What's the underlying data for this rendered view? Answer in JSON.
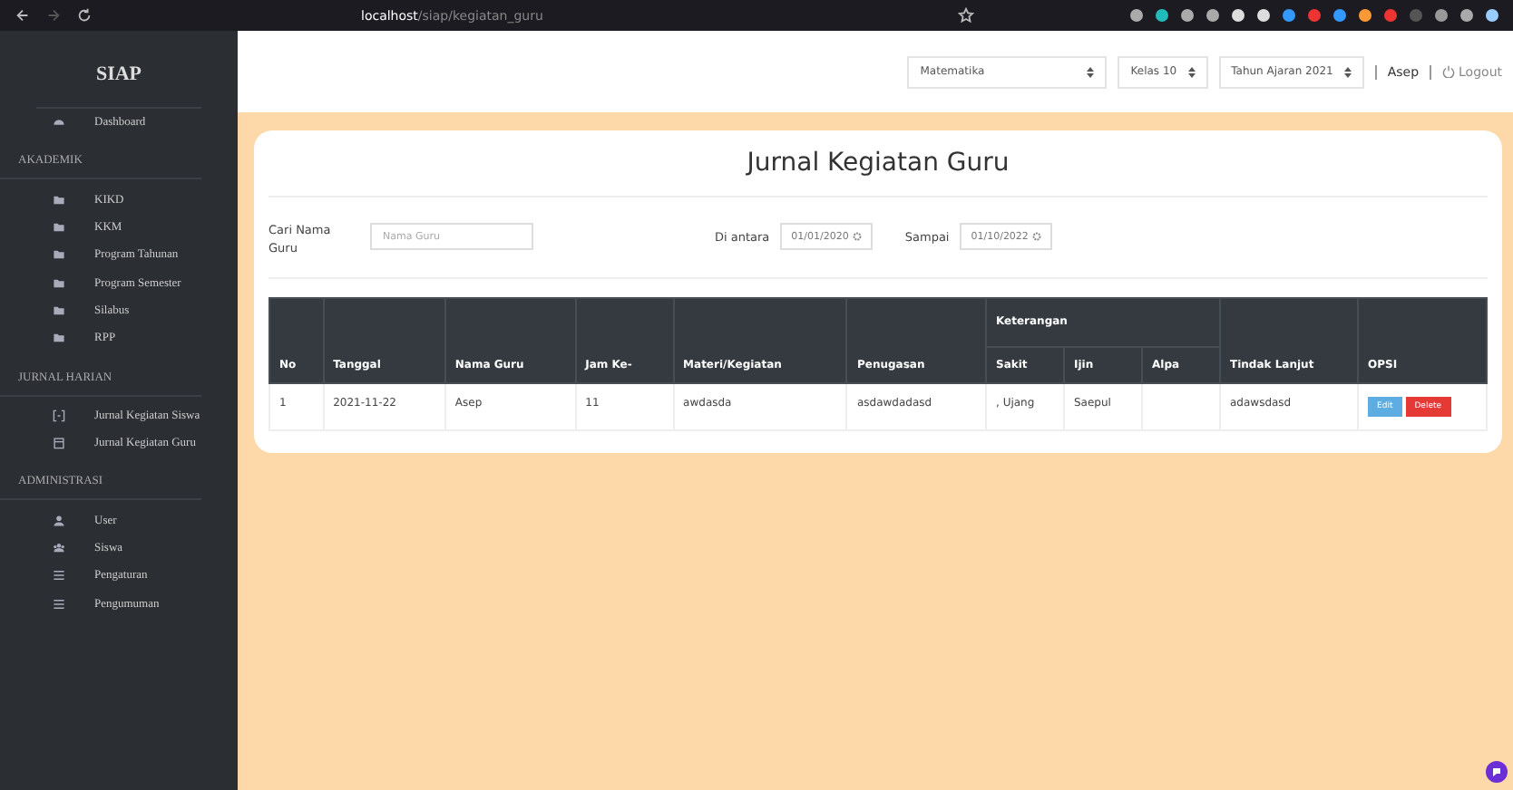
{
  "browser": {
    "url_host": "localhost",
    "url_path": "/siap/kegiatan_guru"
  },
  "sidebar": {
    "brand": "SIAP",
    "items": [
      {
        "kind": "gauge",
        "label": "Dashboard",
        "selected": false
      },
      {
        "kind": "heading",
        "label": "AKADEMIK"
      },
      {
        "kind": "folder",
        "label": "KIKD",
        "selected": false
      },
      {
        "kind": "folder",
        "label": "KKM",
        "selected": false
      },
      {
        "kind": "folder",
        "label": "Program Tahunan",
        "selected": false
      },
      {
        "kind": "folder",
        "label": "Program Semester",
        "selected": false
      },
      {
        "kind": "folder",
        "label": "Silabus",
        "selected": false
      },
      {
        "kind": "folder",
        "label": "RPP",
        "selected": false
      },
      {
        "kind": "heading",
        "label": "JURNAL HARIAN"
      },
      {
        "kind": "brackets",
        "label": "Jurnal Kegiatan Siswa",
        "selected": false
      },
      {
        "kind": "calendar",
        "label": "Jurnal Kegiatan Guru",
        "selected": false
      },
      {
        "kind": "heading",
        "label": "ADMINISTRASI"
      },
      {
        "kind": "user",
        "label": "User",
        "selected": false
      },
      {
        "kind": "users",
        "label": "Siswa",
        "selected": false
      },
      {
        "kind": "bars",
        "label": "Pengaturan",
        "selected": false
      },
      {
        "kind": "bars",
        "label": "Pengumuman",
        "selected": false
      }
    ]
  },
  "header": {
    "selects": [
      {
        "value": "Matematika"
      },
      {
        "value": "Kelas 10"
      },
      {
        "value": "Tahun Ajaran 2021"
      }
    ],
    "user": "Asep",
    "logout": "Logout"
  },
  "card": {
    "title": "Jurnal Kegiatan Guru",
    "filters": {
      "search_label": "Cari Nama Guru",
      "search_placeholder": "Nama Guru",
      "from_label": "Di antara",
      "from_value": "01/01/2020",
      "to_label": "Sampai",
      "to_value": "01/10/2022"
    },
    "table": {
      "columns": [
        "No",
        "Tanggal",
        "Nama Guru",
        "Jam Ke-",
        "Materi/Kegiatan",
        "Penugasan",
        "Keterangan",
        "Tindak Lanjut",
        "OPSI"
      ],
      "sub_columns": [
        "Sakit",
        "Ijin",
        "Alpa"
      ],
      "rows": [
        {
          "no": "1",
          "tanggal": "2021-11-22",
          "nama_guru": "Asep",
          "jam_ke": "11",
          "materi": "awdasda",
          "penugasan": "asdawdadasd",
          "sakit": ", Ujang",
          "ijin": "Saepul",
          "tindak_lanjut": "adawsdasd",
          "actions": [
            "Edit",
            "Delete"
          ]
        }
      ]
    }
  }
}
